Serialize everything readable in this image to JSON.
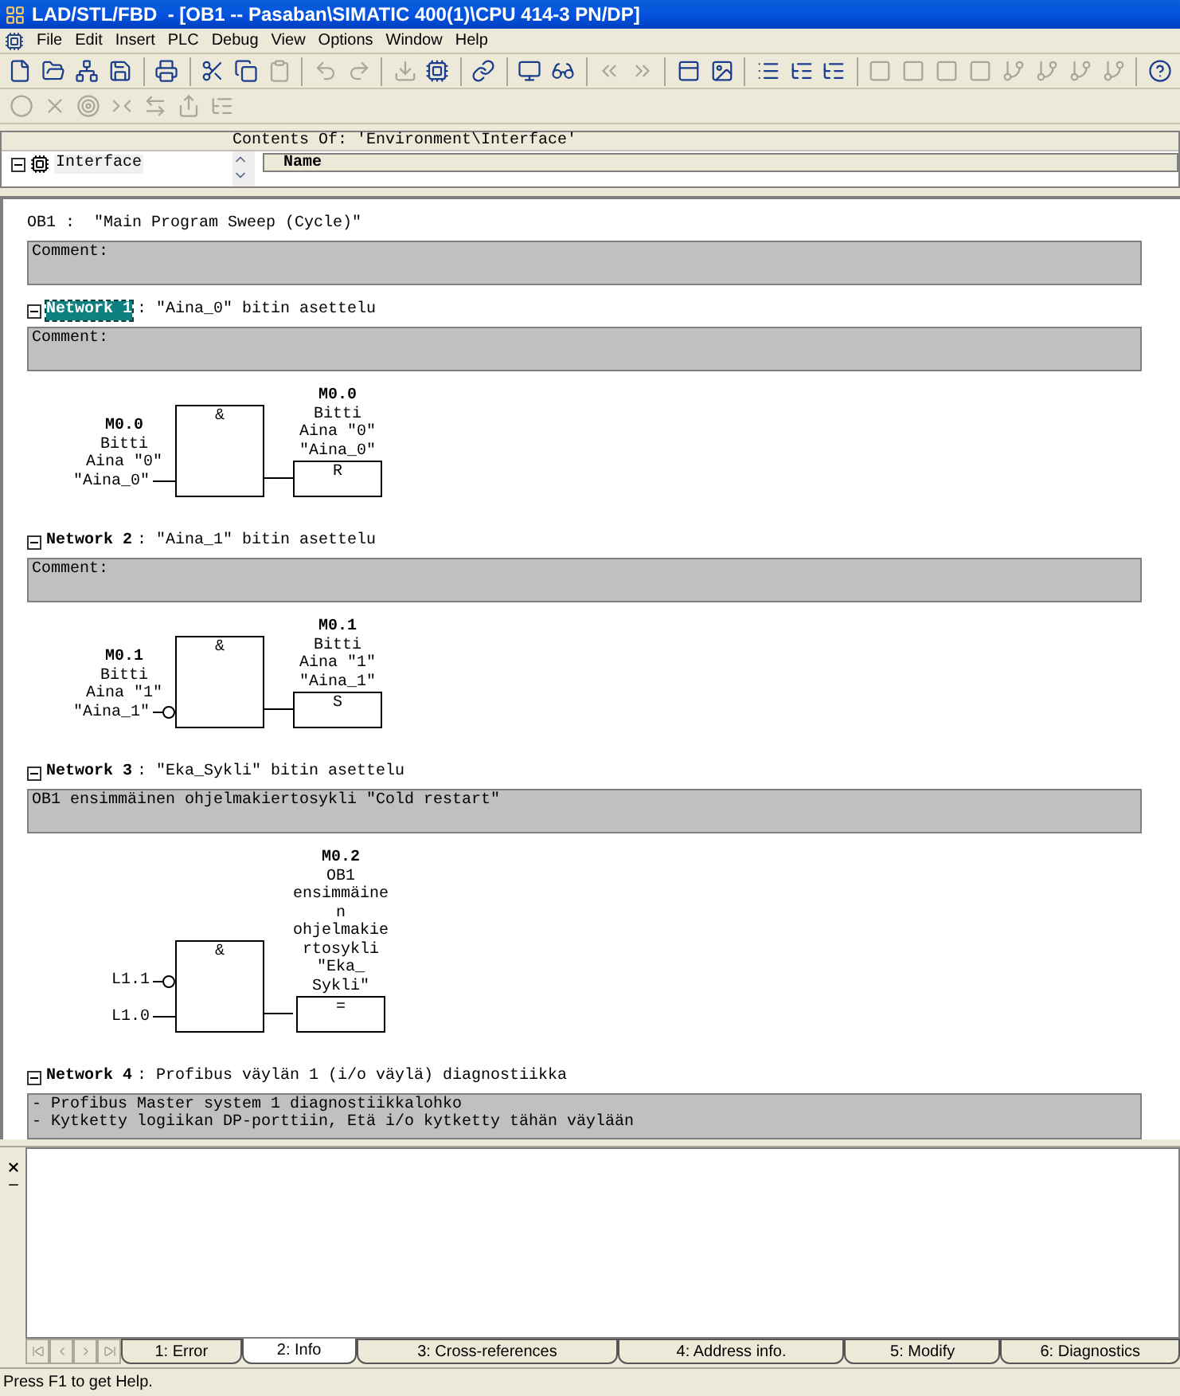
{
  "window": {
    "title": "LAD/STL/FBD  - [OB1 -- Pasaban\\SIMATIC 400(1)\\CPU 414-3 PN/DP]"
  },
  "menu": [
    "File",
    "Edit",
    "Insert",
    "PLC",
    "Debug",
    "View",
    "Options",
    "Window",
    "Help"
  ],
  "toolbar": [
    {
      "kind": "new",
      "disabled": false
    },
    {
      "kind": "open",
      "disabled": false
    },
    {
      "kind": "nodes",
      "disabled": false
    },
    {
      "kind": "save",
      "disabled": false
    },
    {
      "kind": "sep"
    },
    {
      "kind": "print",
      "disabled": false
    },
    {
      "kind": "sep"
    },
    {
      "kind": "cut",
      "disabled": false
    },
    {
      "kind": "copy",
      "disabled": false
    },
    {
      "kind": "paste",
      "disabled": true
    },
    {
      "kind": "sep"
    },
    {
      "kind": "undo",
      "disabled": true
    },
    {
      "kind": "redo",
      "disabled": true
    },
    {
      "kind": "sep"
    },
    {
      "kind": "download",
      "disabled": true
    },
    {
      "kind": "module",
      "disabled": false
    },
    {
      "kind": "sep"
    },
    {
      "kind": "link",
      "disabled": false
    },
    {
      "kind": "sep"
    },
    {
      "kind": "monitor",
      "disabled": false
    },
    {
      "kind": "glasses",
      "disabled": false
    },
    {
      "kind": "sep"
    },
    {
      "kind": "first",
      "disabled": true
    },
    {
      "kind": "last",
      "disabled": true
    },
    {
      "kind": "sep"
    },
    {
      "kind": "panel",
      "disabled": false
    },
    {
      "kind": "image",
      "disabled": false
    },
    {
      "kind": "sep"
    },
    {
      "kind": "list",
      "disabled": false
    },
    {
      "kind": "tree",
      "disabled": false
    },
    {
      "kind": "tree",
      "disabled": false
    },
    {
      "kind": "sep"
    },
    {
      "kind": "box",
      "disabled": true
    },
    {
      "kind": "box",
      "disabled": true
    },
    {
      "kind": "box",
      "disabled": true
    },
    {
      "kind": "box",
      "disabled": true
    },
    {
      "kind": "branch",
      "disabled": true
    },
    {
      "kind": "branch",
      "disabled": true
    },
    {
      "kind": "branch",
      "disabled": true
    },
    {
      "kind": "branch",
      "disabled": true
    },
    {
      "kind": "sep"
    },
    {
      "kind": "help",
      "disabled": false
    }
  ],
  "toolbar2": [
    {
      "kind": "dot",
      "disabled": true
    },
    {
      "kind": "cross",
      "disabled": true
    },
    {
      "kind": "target",
      "disabled": true
    },
    {
      "kind": "forward",
      "disabled": true
    },
    {
      "kind": "arrows",
      "disabled": true
    },
    {
      "kind": "export",
      "disabled": true
    },
    {
      "kind": "tree",
      "disabled": true
    }
  ],
  "interface_panel": {
    "heading": "Contents Of: 'Environment\\Interface'",
    "tree": [
      {
        "label": "Interface",
        "expanded": true
      }
    ],
    "columns": [
      "Name"
    ]
  },
  "block": {
    "title": "OB1 :  \"Main Program Sweep (Cycle)\"",
    "comment": [
      "Comment:"
    ]
  },
  "networks": [
    {
      "label": "Network 1",
      "title": ": \"Aina_0\" bitin asettelu",
      "selected": true,
      "expanded": true,
      "comment": [
        "Comment:"
      ],
      "inputs": [
        {
          "address": "M0.0",
          "lines": [
            "Bitti",
            "Aina \"0\"",
            "\"Aina_0\""
          ],
          "negated": false
        }
      ],
      "gate": "&",
      "output": {
        "address": "M0.0",
        "lines": [
          "Bitti",
          "Aina \"0\"",
          "\"Aina_0\""
        ],
        "coil": "R"
      }
    },
    {
      "label": "Network 2",
      "title": ": \"Aina_1\" bitin asettelu",
      "selected": false,
      "expanded": true,
      "comment": [
        "Comment:"
      ],
      "inputs": [
        {
          "address": "M0.1",
          "lines": [
            "Bitti",
            "Aina \"1\"",
            "\"Aina_1\""
          ],
          "negated": true
        }
      ],
      "gate": "&",
      "output": {
        "address": "M0.1",
        "lines": [
          "Bitti",
          "Aina \"1\"",
          "\"Aina_1\""
        ],
        "coil": "S"
      }
    },
    {
      "label": "Network 3",
      "title": ": \"Eka_Sykli\" bitin asettelu",
      "selected": false,
      "expanded": true,
      "comment": [
        "OB1 ensimmäinen ohjelmakiertosykli \"Cold restart\""
      ],
      "inputs": [
        {
          "lines": [
            "L1.1"
          ],
          "negated": true
        },
        {
          "lines": [
            "L1.0"
          ],
          "negated": false
        }
      ],
      "gate": "&",
      "output": {
        "address": "M0.2",
        "lines": [
          "OB1",
          "ensimmäine",
          "n",
          "ohjelmakie",
          "rtosykli",
          "\"Eka_",
          "Sykli\""
        ],
        "coil": "="
      }
    },
    {
      "label": "Network 4",
      "title": ": Profibus väylän 1 (i/o väylä) diagnostiikka",
      "selected": false,
      "expanded": true,
      "comment": [
        "- Profibus Master system 1 diagnostiikkalohko",
        "- Kytketty logiikan DP-porttiin, Etä i/o kytketty tähän väylään"
      ]
    }
  ],
  "output_tabs": [
    {
      "label": "1: Error",
      "selected": false
    },
    {
      "label": "2: Info",
      "selected": true
    },
    {
      "label": "3: Cross-references",
      "selected": false
    },
    {
      "label": "4: Address info.",
      "selected": false
    },
    {
      "label": "5: Modify",
      "selected": false
    },
    {
      "label": "6: Diagnostics",
      "selected": false
    }
  ],
  "status_bar": "Press F1 to get Help."
}
